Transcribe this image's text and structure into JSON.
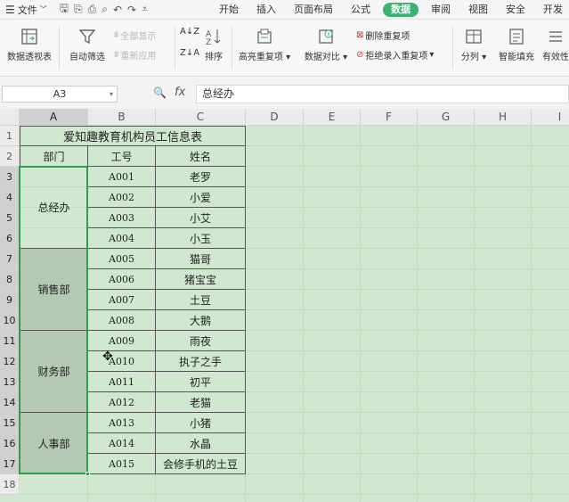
{
  "menu": {
    "file_label": "文件",
    "tabs": [
      "开始",
      "插入",
      "页面布局",
      "公式",
      "数据",
      "审阅",
      "视图",
      "安全",
      "开发"
    ],
    "active_tab": "数据"
  },
  "ribbon": {
    "pivot": "数据透视表",
    "autofilter": "自动筛选",
    "show_all": "全部显示",
    "reapply": "重新应用",
    "sort": "排序",
    "highlight_dup": "高亮重复项",
    "compare": "数据对比",
    "delete_dup": "删除重复项",
    "reject_dup": "拒绝录入重复项",
    "split": "分列",
    "smart_fill": "智能填充",
    "validity": "有效性"
  },
  "formula_bar": {
    "name_box": "A3",
    "fx": "fx",
    "content": "总经办"
  },
  "sheet": {
    "columns": [
      "A",
      "B",
      "C",
      "D",
      "E",
      "F",
      "G",
      "H",
      "I"
    ],
    "rows": [
      "1",
      "2",
      "3",
      "4",
      "5",
      "6",
      "7",
      "8",
      "9",
      "10",
      "11",
      "12",
      "13",
      "14",
      "15",
      "16",
      "17",
      "18"
    ],
    "title": "爱知趣教育机构员工信息表",
    "headers": {
      "dept": "部门",
      "id": "工号",
      "name": "姓名"
    },
    "departments": [
      {
        "name": "总经办",
        "start": 3,
        "span": 4
      },
      {
        "name": "销售部",
        "start": 7,
        "span": 4
      },
      {
        "name": "财务部",
        "start": 11,
        "span": 4
      },
      {
        "name": "人事部",
        "start": 15,
        "span": 3
      }
    ],
    "records": [
      {
        "id": "A001",
        "name": "老罗"
      },
      {
        "id": "A002",
        "name": "小爱"
      },
      {
        "id": "A003",
        "name": "小艾"
      },
      {
        "id": "A004",
        "name": "小玉"
      },
      {
        "id": "A005",
        "name": "猫哥"
      },
      {
        "id": "A006",
        "name": "猪宝宝"
      },
      {
        "id": "A007",
        "name": "土豆"
      },
      {
        "id": "A008",
        "name": "大鹅"
      },
      {
        "id": "A009",
        "name": "雨夜"
      },
      {
        "id": "A010",
        "name": "执子之手"
      },
      {
        "id": "A011",
        "name": "初平"
      },
      {
        "id": "A012",
        "name": "老猫"
      },
      {
        "id": "A013",
        "name": "小猪"
      },
      {
        "id": "A014",
        "name": "水晶"
      },
      {
        "id": "A015",
        "name": "会修手机的土豆"
      }
    ]
  }
}
